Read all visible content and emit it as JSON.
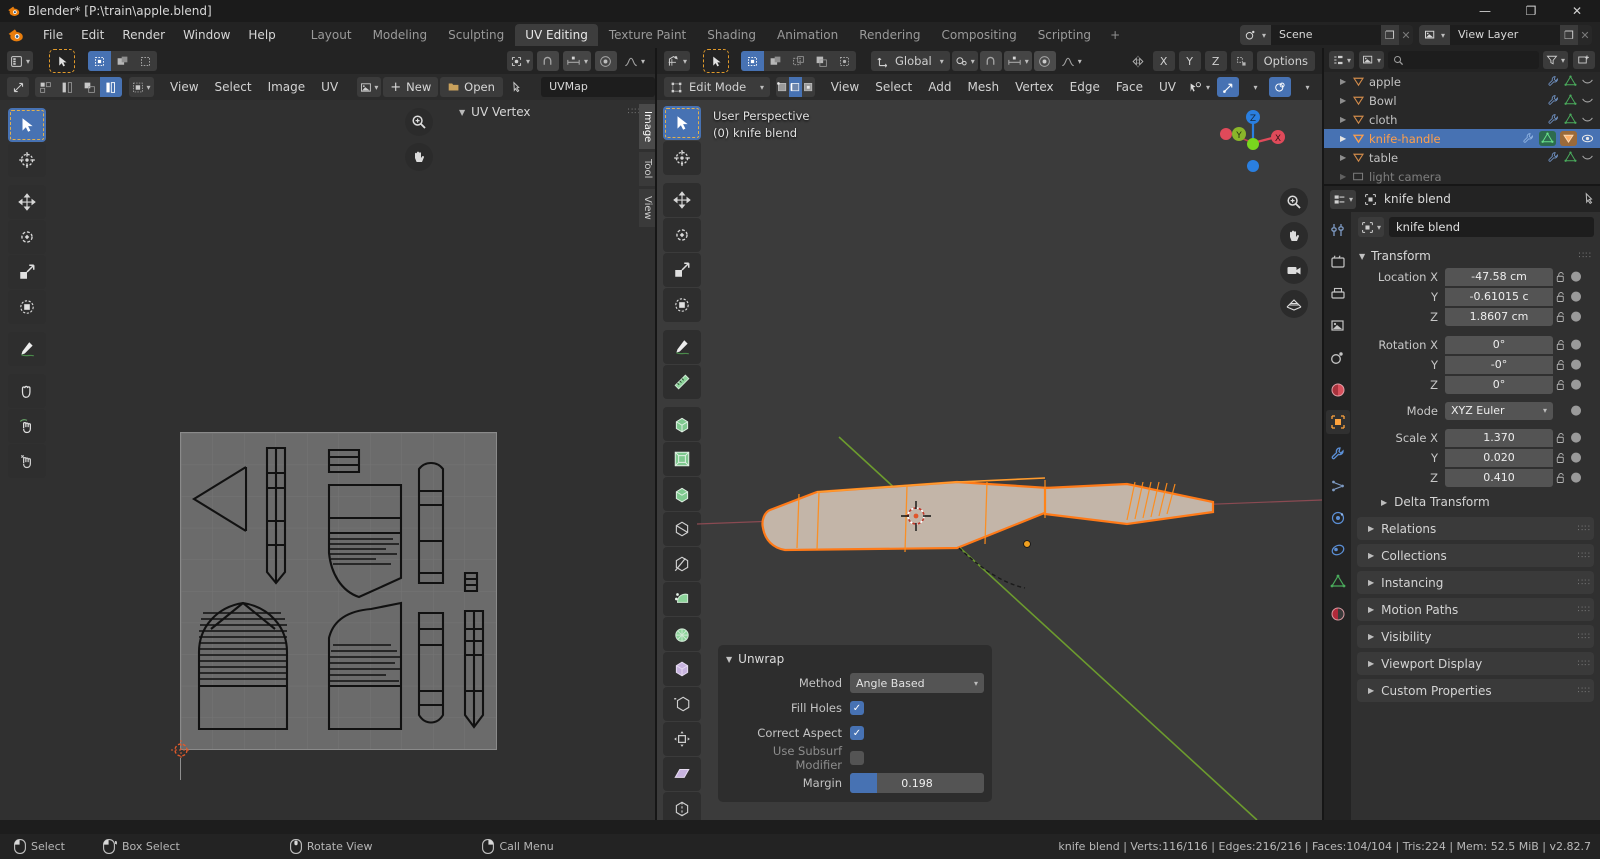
{
  "window": {
    "title": "Blender* [P:\\train\\apple.blend]",
    "minimize": "—",
    "maximize": "❐",
    "close": "✕"
  },
  "topbar": {
    "menus": [
      "File",
      "Edit",
      "Render",
      "Window",
      "Help"
    ],
    "workspaces": [
      {
        "label": "Layout",
        "active": false
      },
      {
        "label": "Modeling",
        "active": false
      },
      {
        "label": "Sculpting",
        "active": false
      },
      {
        "label": "UV Editing",
        "active": true
      },
      {
        "label": "Texture Paint",
        "active": false
      },
      {
        "label": "Shading",
        "active": false
      },
      {
        "label": "Animation",
        "active": false
      },
      {
        "label": "Rendering",
        "active": false
      },
      {
        "label": "Compositing",
        "active": false
      },
      {
        "label": "Scripting",
        "active": false
      },
      {
        "label": "+",
        "active": false
      }
    ],
    "scene": {
      "value": "Scene",
      "new_btn": "❐",
      "close_btn": "✕"
    },
    "view_layer": {
      "value": "View Layer",
      "new_btn": "❐",
      "close_btn": "✕"
    }
  },
  "uv_editor": {
    "menus": [
      "View",
      "Select",
      "Image",
      "UV"
    ],
    "new_button": "New",
    "open_button": "Open",
    "uvmap_field": "UVMap",
    "panel_title": "UV Vertex",
    "side_tabs": [
      {
        "label": "Image",
        "active": true
      },
      {
        "label": "Tool",
        "active": false
      },
      {
        "label": "View",
        "active": false
      }
    ],
    "tools": [
      {
        "name": "tweak-tool",
        "active": true
      },
      {
        "name": "cursor-tool",
        "active": false
      },
      {
        "name": "move-tool",
        "active": false
      },
      {
        "name": "rotate-tool",
        "active": false
      },
      {
        "name": "scale-tool",
        "active": false
      },
      {
        "name": "transform-tool",
        "active": false
      },
      {
        "name": "annotate-tool",
        "active": false
      },
      {
        "name": "grab-tool",
        "active": false
      },
      {
        "name": "relax-tool",
        "active": false
      },
      {
        "name": "pinch-tool",
        "active": false
      }
    ]
  },
  "viewport": {
    "mode": "Edit Mode",
    "orientation": "Global",
    "options_label": "Options",
    "menus": [
      "View",
      "Select",
      "Add",
      "Mesh",
      "Vertex",
      "Edge",
      "Face",
      "UV"
    ],
    "axis_buttons": [
      "X",
      "Y",
      "Z"
    ],
    "info_line1": "User Perspective",
    "info_line2": "(0) knife blend",
    "gizmo_axes": [
      {
        "label": "Z",
        "color": "#2a7fe0"
      },
      {
        "label": "Y",
        "color": "#8ab52a"
      },
      {
        "label": "X",
        "color": "#e04a5a"
      }
    ]
  },
  "unwrap_panel": {
    "title": "Unwrap",
    "method_label": "Method",
    "method_value": "Angle Based",
    "fill_holes_label": "Fill Holes",
    "fill_holes_checked": true,
    "correct_aspect_label": "Correct Aspect",
    "correct_aspect_checked": true,
    "use_subsurf_label": "Use Subsurf Modifier",
    "use_subsurf_checked": false,
    "margin_label": "Margin",
    "margin_value": "0.198",
    "margin_fill_pct": 19.8
  },
  "outliner": {
    "search_placeholder": "",
    "rows": [
      {
        "name": "apple",
        "selected": false,
        "expandable": true
      },
      {
        "name": "Bowl",
        "selected": false,
        "expandable": true
      },
      {
        "name": "cloth",
        "selected": false,
        "expandable": true
      },
      {
        "name": "knife-handle",
        "selected": true,
        "expandable": true
      },
      {
        "name": "table",
        "selected": false,
        "expandable": true
      },
      {
        "name": "light camera",
        "selected": false,
        "expandable": true
      }
    ]
  },
  "properties": {
    "breadcrumb_object": "knife blend",
    "id_name": "knife blend",
    "transform": {
      "title": "Transform",
      "location_label": "Location X",
      "location": [
        {
          "axis": "Location X",
          "value": "-47.58 cm"
        },
        {
          "axis": "Y",
          "value": "-0.61015 c"
        },
        {
          "axis": "Z",
          "value": "1.8607 cm"
        }
      ],
      "rotation": [
        {
          "axis": "Rotation X",
          "value": "0°"
        },
        {
          "axis": "Y",
          "value": "-0°"
        },
        {
          "axis": "Z",
          "value": "0°"
        }
      ],
      "mode_label": "Mode",
      "mode_value": "XYZ Euler",
      "scale": [
        {
          "axis": "Scale X",
          "value": "1.370"
        },
        {
          "axis": "Y",
          "value": "0.020"
        },
        {
          "axis": "Z",
          "value": "0.410"
        }
      ],
      "delta_transform": "Delta Transform"
    },
    "sections": [
      "Relations",
      "Collections",
      "Instancing",
      "Motion Paths",
      "Visibility",
      "Viewport Display",
      "Custom Properties"
    ],
    "tabs": [
      {
        "name": "tool-tab",
        "active": false
      },
      {
        "name": "render-tab",
        "active": false
      },
      {
        "name": "output-tab",
        "active": false
      },
      {
        "name": "view-layer-tab",
        "active": false
      },
      {
        "name": "scene-tab",
        "active": false
      },
      {
        "name": "world-tab",
        "active": false
      },
      {
        "name": "object-tab",
        "active": true
      },
      {
        "name": "modifier-tab",
        "active": false
      },
      {
        "name": "particles-tab",
        "active": false
      },
      {
        "name": "physics-tab",
        "active": false
      },
      {
        "name": "constraints-tab",
        "active": false
      },
      {
        "name": "data-tab",
        "active": false
      },
      {
        "name": "material-tab",
        "active": false
      }
    ]
  },
  "statusbar": {
    "hints": [
      {
        "icon": "lmb",
        "label": "Select"
      },
      {
        "icon": "lmb-drag",
        "label": "Box Select"
      },
      {
        "icon": "mmb",
        "label": "Rotate View"
      },
      {
        "icon": "rmb",
        "label": "Call Menu"
      }
    ],
    "stats": "knife blend | Verts:116/116 | Edges:216/216 | Faces:104/104 | Tris:224 | Mem: 52.5 MiB | v2.82.7"
  },
  "colors": {
    "accent_blue": "#4772b3",
    "active_orange": "#ff8c1a",
    "selected_text": "#ff9f4a",
    "axis_x": "#e04a5a",
    "axis_y": "#8ab52a",
    "axis_z": "#2a7fe0",
    "mesh_green": "#6ec07b",
    "bg_dark": "#232323",
    "bg_editor": "#303030",
    "bg_viewport": "#3b3b3b"
  }
}
